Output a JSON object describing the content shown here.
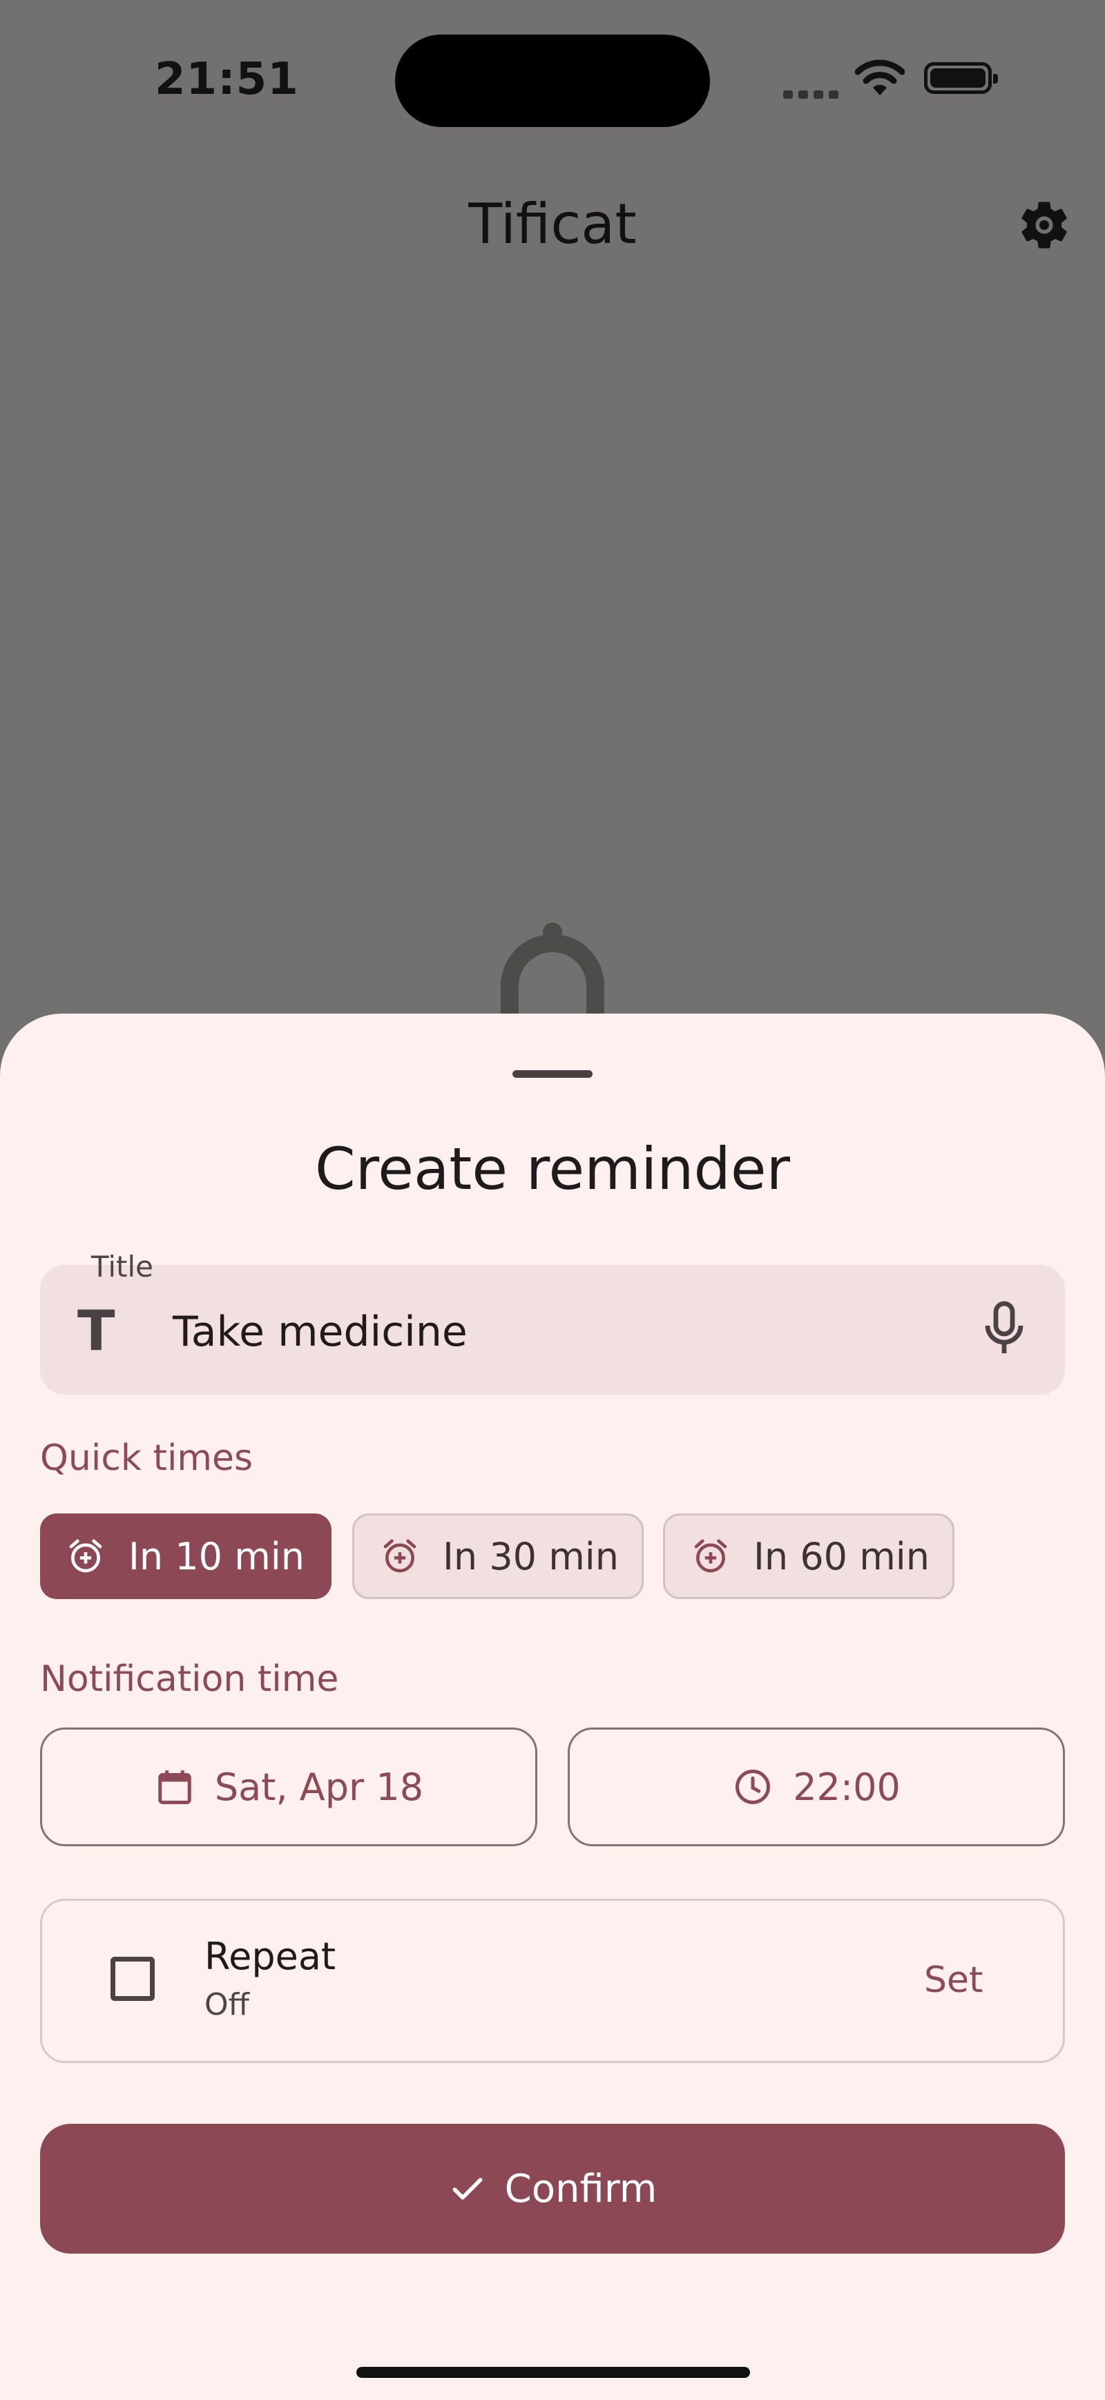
{
  "status_bar": {
    "time": "21:51"
  },
  "app_bar": {
    "title": "Tificat"
  },
  "sheet": {
    "title": "Create reminder",
    "title_field": {
      "label": "Title",
      "value": "Take medicine"
    },
    "quick_times": {
      "label": "Quick times",
      "chips": [
        {
          "label": "In 10 min",
          "selected": true
        },
        {
          "label": "In 30 min",
          "selected": false
        },
        {
          "label": "In 60 min",
          "selected": false
        }
      ]
    },
    "notification_time": {
      "label": "Notification time",
      "date": "Sat, Apr 18",
      "time": "22:00"
    },
    "repeat": {
      "label": "Repeat",
      "value": "Off",
      "action": "Set",
      "checked": false
    },
    "confirm_label": "Confirm"
  },
  "colors": {
    "accent": "#8c4854",
    "sheet_background": "#fdf0ef",
    "field_background": "#f2dfe0",
    "scrim": "#727070"
  },
  "icons": [
    "gear-icon",
    "bell-icon",
    "text-icon",
    "mic-icon",
    "alarm-add-icon",
    "calendar-icon",
    "clock-icon",
    "check-icon"
  ]
}
